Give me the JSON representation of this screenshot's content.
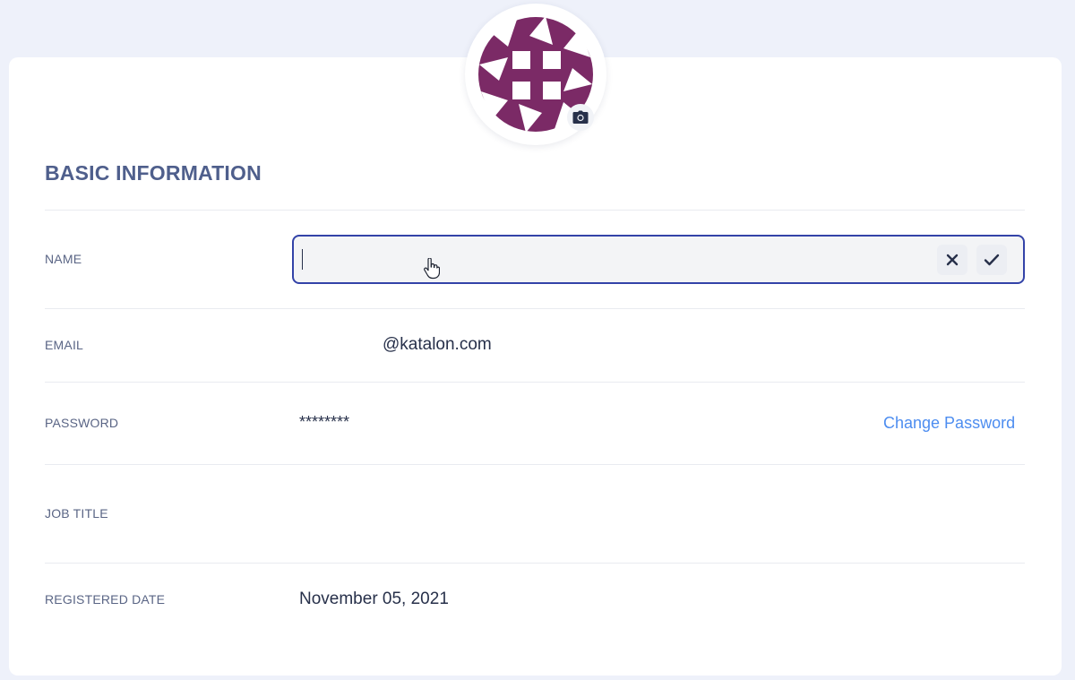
{
  "section": {
    "title": "BASIC INFORMATION"
  },
  "fields": {
    "name": {
      "label": "NAME",
      "value": ""
    },
    "email": {
      "label": "EMAIL",
      "value": "@katalon.com"
    },
    "password": {
      "label": "PASSWORD",
      "value": "********",
      "action": "Change Password"
    },
    "job_title": {
      "label": "JOB TITLE",
      "value": ""
    },
    "registered_date": {
      "label": "REGISTERED DATE",
      "value": "November 05, 2021"
    }
  },
  "icons": {
    "avatar": "identicon-avatar",
    "camera": "camera-icon",
    "cancel": "close-icon",
    "confirm": "check-icon",
    "cursor": "hand-pointer-icon"
  },
  "colors": {
    "accent": "#3343a8",
    "link": "#4d8df0",
    "title": "#4f5f8c",
    "avatar": "#7b2a66"
  }
}
